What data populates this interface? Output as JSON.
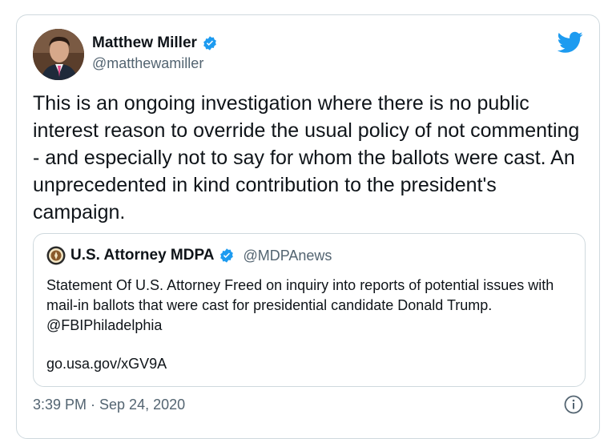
{
  "author": {
    "display_name": "Matthew Miller",
    "handle": "@matthewamiller",
    "verified": true
  },
  "tweet": {
    "text": "This is an ongoing investigation where there is no public interest reason to override the usual policy of not commenting - and especially not to say for whom the ballots were cast. An unprecedented in kind contribution to the president's campaign.",
    "timestamp": "3:39 PM · Sep 24, 2020"
  },
  "quoted_tweet": {
    "display_name": "U.S. Attorney MDPA",
    "handle": "@MDPAnews",
    "verified": true,
    "text": "Statement Of U.S. Attorney Freed on inquiry into reports of potential issues with mail-in ballots that were cast for presidential candidate Donald Trump. @FBIPhiladelphia",
    "link": "go.usa.gov/xGV9A"
  },
  "icons": {
    "brand": "twitter-bird-icon",
    "verified": "verified-badge-icon",
    "info": "info-icon",
    "seal": "doj-seal-icon"
  },
  "colors": {
    "twitter_blue": "#1d9bf0",
    "text_primary": "#0f1419",
    "text_secondary": "#536471",
    "border": "#cfd9de"
  }
}
